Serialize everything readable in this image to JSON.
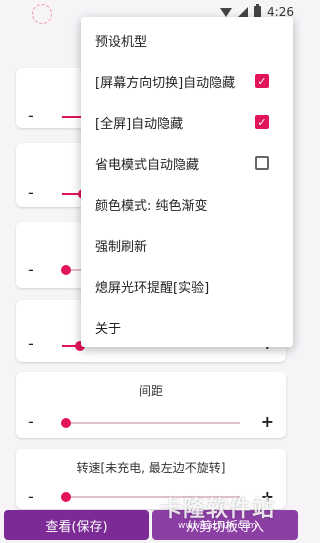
{
  "status": {
    "time": "4:26"
  },
  "menu": {
    "items": [
      {
        "label": "预设机型"
      },
      {
        "label": "[屏幕方向切换]自动隐藏",
        "checked": true
      },
      {
        "label": "[全屏]自动隐藏",
        "checked": true
      },
      {
        "label": "省电模式自动隐藏",
        "checked": false
      },
      {
        "label": "颜色模式: 纯色渐变"
      },
      {
        "label": "强制刷新"
      },
      {
        "label": "熄屏光环提醒[实验]"
      },
      {
        "label": "关于"
      }
    ]
  },
  "sliders": [
    {
      "title": "",
      "value": 0.22
    },
    {
      "title": "",
      "value": 0.12
    },
    {
      "title": "",
      "value": 0.02
    },
    {
      "title": "",
      "value": 0.1
    },
    {
      "title": "间距",
      "value": 0.02
    },
    {
      "title": "转速[未充电, 最左边不旋转]",
      "value": 0.02
    }
  ],
  "controls": {
    "minus": "-",
    "plus": "+"
  },
  "bottom": {
    "save_label": "查看(保存)",
    "import_label": "从剪切板导入"
  },
  "watermark": {
    "text": "卡隆软件站",
    "url": "www.kazhun.com"
  },
  "colors": {
    "accent": "#e2145a",
    "button": "#7b2a96"
  }
}
